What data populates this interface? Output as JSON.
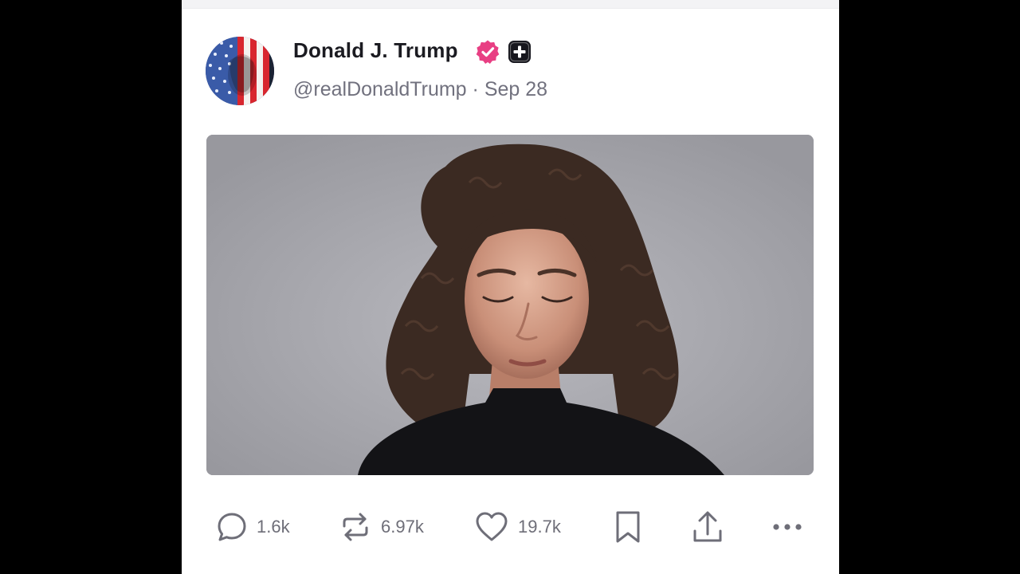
{
  "post": {
    "author": {
      "display_name": "Donald J. Trump",
      "handle": "@realDonaldTrump",
      "separator": "·",
      "date": "Sep 28",
      "avatar_icon": "american-flag-portrait-avatar",
      "verified_icon": "verified-check-icon",
      "badge_icon": "plus-badge-icon"
    },
    "media": {
      "type": "video",
      "description_icon": "woman-portrait-video-frame"
    },
    "actions": {
      "reply_count": "1.6k",
      "repost_count": "6.97k",
      "like_count": "19.7k"
    }
  },
  "colors": {
    "verified": "#e83f83",
    "text_primary": "#1b1b21",
    "text_secondary": "#71717e",
    "icon": "#6e6e78"
  }
}
